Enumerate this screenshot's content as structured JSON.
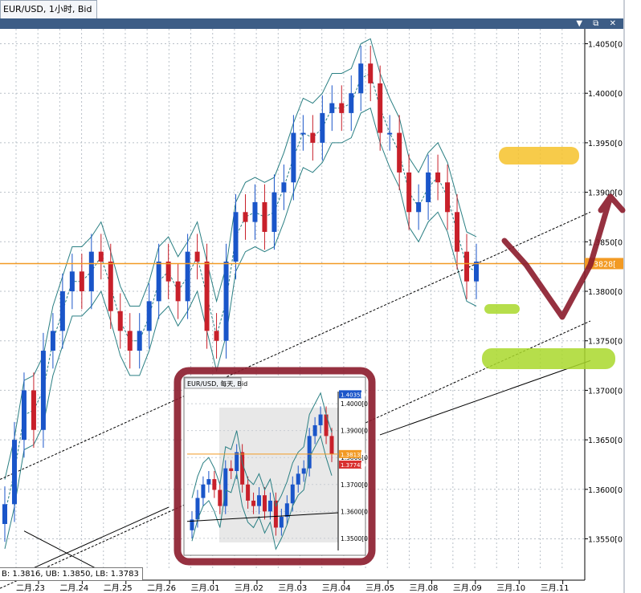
{
  "tab": {
    "title": "EUR/USD, 1小时, Bid"
  },
  "window_buttons": "▼ ⧉ ✕",
  "indicator_label": "B: 1.3816, UB: 1.3850, LB: 1.3783",
  "colors": {
    "bull": "#1a55c9",
    "bear": "#c8202a",
    "band": "#2a7f83",
    "price_line": "#f29a24",
    "ink": "#8b1b2b",
    "highlight_yellow": "#f6c22a",
    "highlight_green": "#a9d82b"
  },
  "chart_data": {
    "type": "candlestick",
    "title": "EUR/USD, 1小时, Bid",
    "x_categories": [
      "二月.23",
      "二月.24",
      "二月.25",
      "二月.26",
      "三月.01",
      "三月.02",
      "三月.03",
      "三月.04",
      "三月.05",
      "三月.08",
      "三月.09",
      "三月.10",
      "三月.11"
    ],
    "y_ticks": [
      "1.4050[0",
      "1.4000[0",
      "1.3950[0",
      "1.3900[0",
      "1.3850[0",
      "1.3800[0",
      "1.3750[0",
      "1.3700[0",
      "1.3650[0",
      "1.3600[0",
      "1.3550[0"
    ],
    "ylim": [
      1.3518,
      1.4065
    ],
    "current_price": 1.3828,
    "current_price_label": "3828[",
    "close_series": [
      1.3585,
      1.365,
      1.37,
      1.366,
      1.374,
      1.376,
      1.38,
      1.382,
      1.38,
      1.384,
      1.383,
      1.378,
      1.376,
      1.374,
      1.376,
      1.379,
      1.383,
      1.381,
      1.379,
      1.384,
      1.383,
      1.376,
      1.375,
      1.383,
      1.388,
      1.387,
      1.389,
      1.386,
      1.39,
      1.391,
      1.396,
      1.396,
      1.395,
      1.398,
      1.399,
      1.398,
      1.4,
      1.403,
      1.401,
      1.396,
      1.396,
      1.392,
      1.388,
      1.389,
      1.392,
      1.391,
      1.388,
      1.384,
      1.381,
      1.383
    ],
    "bollinger": {
      "note": "B: 1.3816, UB: 1.3850, LB: 1.3783"
    },
    "inset": {
      "title": "EUR/USD, 每天, Bid",
      "y_ticks": [
        "1.4000[0",
        "1.3900[0",
        "1.3800[0",
        "1.3700[0",
        "1.3600[0",
        "1.3500[0"
      ],
      "ylim": [
        1.3455,
        1.4045
      ],
      "price_tags": [
        "1.4035[0",
        "1.3813[0",
        "1.3774[0"
      ],
      "close_series": [
        1.357,
        1.365,
        1.37,
        1.372,
        1.368,
        1.362,
        1.376,
        1.375,
        1.382,
        1.37,
        1.364,
        1.362,
        1.366,
        1.36,
        1.364,
        1.354,
        1.358,
        1.363,
        1.37,
        1.374,
        1.376,
        1.388,
        1.392,
        1.396,
        1.388,
        1.3813
      ]
    }
  }
}
